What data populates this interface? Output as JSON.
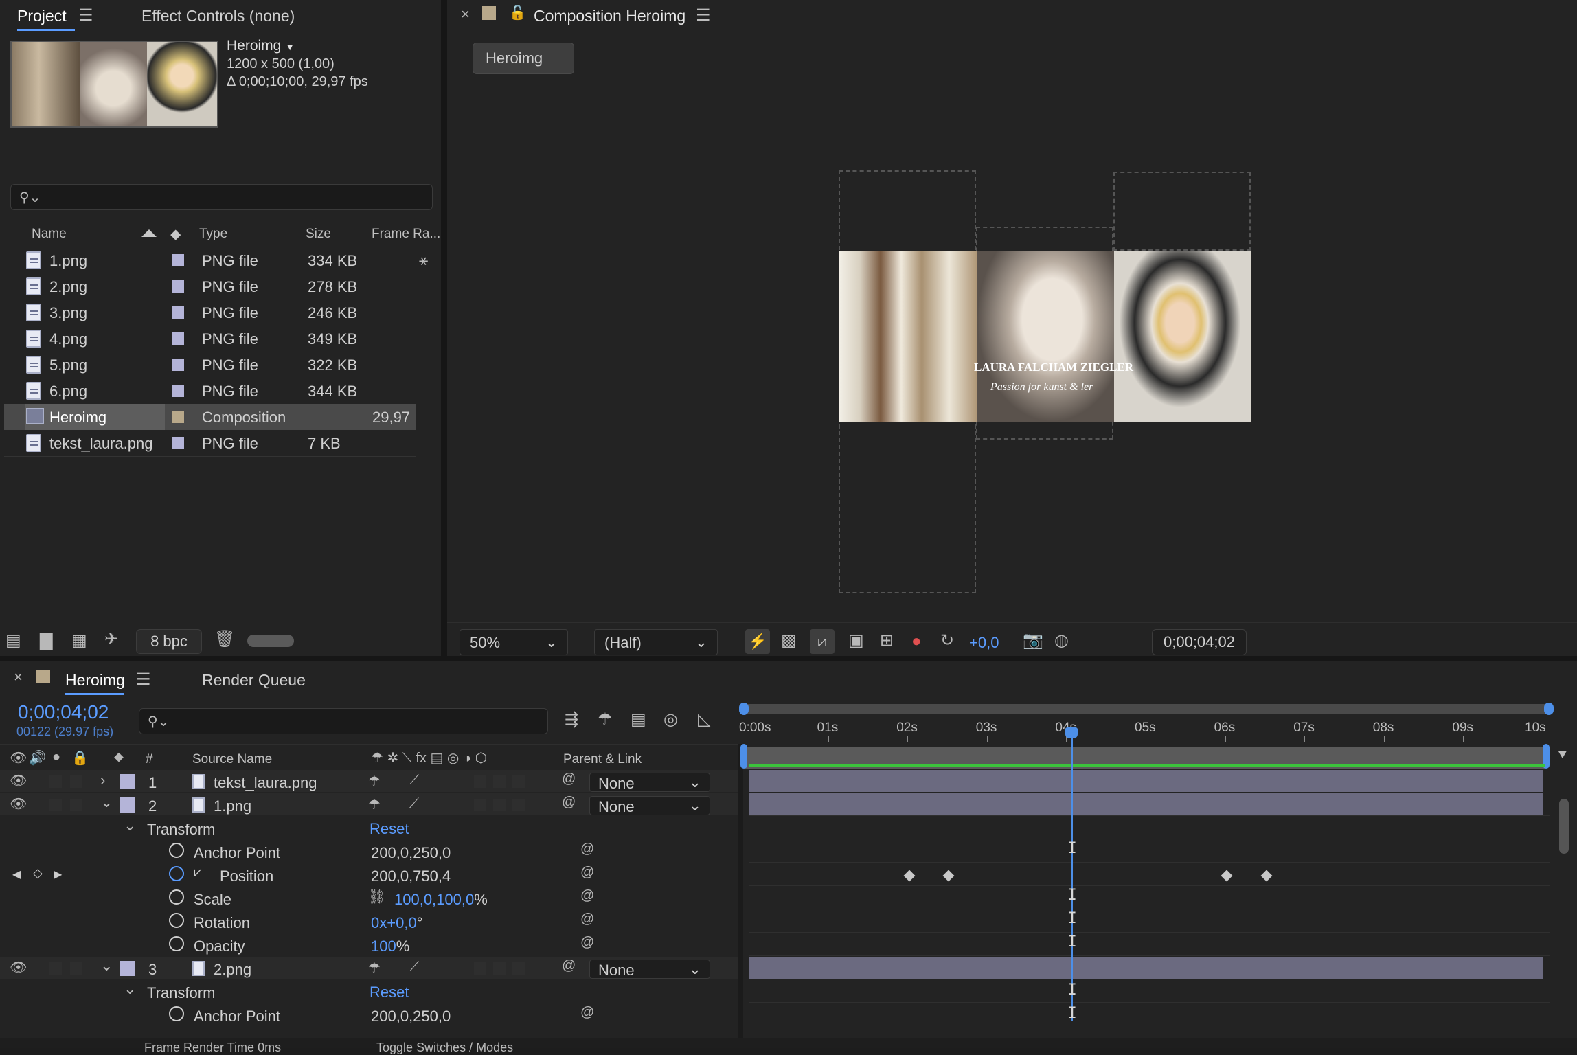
{
  "project": {
    "tab_project": "Project",
    "tab_effect": "Effect Controls (none)",
    "comp_name": "Heroimg",
    "comp_size": "1200 x 500 (1,00)",
    "comp_duration": "Δ 0;00;10;00, 29,97 fps",
    "columns": {
      "name": "Name",
      "type": "Type",
      "size": "Size",
      "frame_rate": "Frame Ra..."
    },
    "items": [
      {
        "name": "1.png",
        "type": "PNG file",
        "size": "334 KB",
        "frame_rate": ""
      },
      {
        "name": "2.png",
        "type": "PNG file",
        "size": "278 KB",
        "frame_rate": ""
      },
      {
        "name": "3.png",
        "type": "PNG file",
        "size": "246 KB",
        "frame_rate": ""
      },
      {
        "name": "4.png",
        "type": "PNG file",
        "size": "349 KB",
        "frame_rate": ""
      },
      {
        "name": "5.png",
        "type": "PNG file",
        "size": "322 KB",
        "frame_rate": ""
      },
      {
        "name": "6.png",
        "type": "PNG file",
        "size": "344 KB",
        "frame_rate": ""
      },
      {
        "name": "Heroimg",
        "type": "Composition",
        "size": "",
        "frame_rate": "29,97"
      },
      {
        "name": "tekst_laura.png",
        "type": "PNG file",
        "size": "7 KB",
        "frame_rate": ""
      }
    ],
    "bpc": "8 bpc"
  },
  "composition": {
    "title": "Composition Heroimg",
    "tab": "Heroimg",
    "overlay_name": "LAURA FALCHAM ZIEGLER",
    "overlay_tagline": "Passion for kunst & ler",
    "zoom": "50%",
    "resolution": "(Half)",
    "exposure": "+0,0",
    "timecode": "0;00;04;02"
  },
  "timeline": {
    "tab": "Heroimg",
    "render_queue": "Render Queue",
    "timecode": "0;00;04;02",
    "frame_info": "00122 (29.97 fps)",
    "col_hash": "#",
    "col_source": "Source Name",
    "col_parent": "Parent & Link",
    "ruler": [
      "0:00s",
      "01s",
      "02s",
      "03s",
      "04s",
      "05s",
      "06s",
      "07s",
      "08s",
      "09s",
      "10s"
    ],
    "layers": [
      {
        "num": "1",
        "name": "tekst_laura.png",
        "parent": "None"
      },
      {
        "num": "2",
        "name": "1.png",
        "parent": "None"
      },
      {
        "num": "3",
        "name": "2.png",
        "parent": "None"
      }
    ],
    "transform_label": "Transform",
    "reset_label": "Reset",
    "props": {
      "anchor": {
        "label": "Anchor Point",
        "value": "200,0,250,0"
      },
      "position": {
        "label": "Position",
        "value": "200,0,750,4"
      },
      "scale": {
        "label": "Scale",
        "value": "100,0,100,0",
        "unit": "%"
      },
      "rotation": {
        "label": "Rotation",
        "value_a": "0x",
        "value_b": "+0,0",
        "unit": "°"
      },
      "opacity": {
        "label": "Opacity",
        "value": "100",
        "unit": "%"
      },
      "anchor3": {
        "label": "Anchor Point",
        "value": "200,0,250,0"
      }
    },
    "bottom_left": "Frame Render Time",
    "bottom_left_value": "0ms",
    "bottom_mid": "Toggle Switches / Modes",
    "current_time_s": 4.07,
    "keyframes_position_s": [
      2.02,
      2.52,
      6.02,
      6.52
    ]
  }
}
